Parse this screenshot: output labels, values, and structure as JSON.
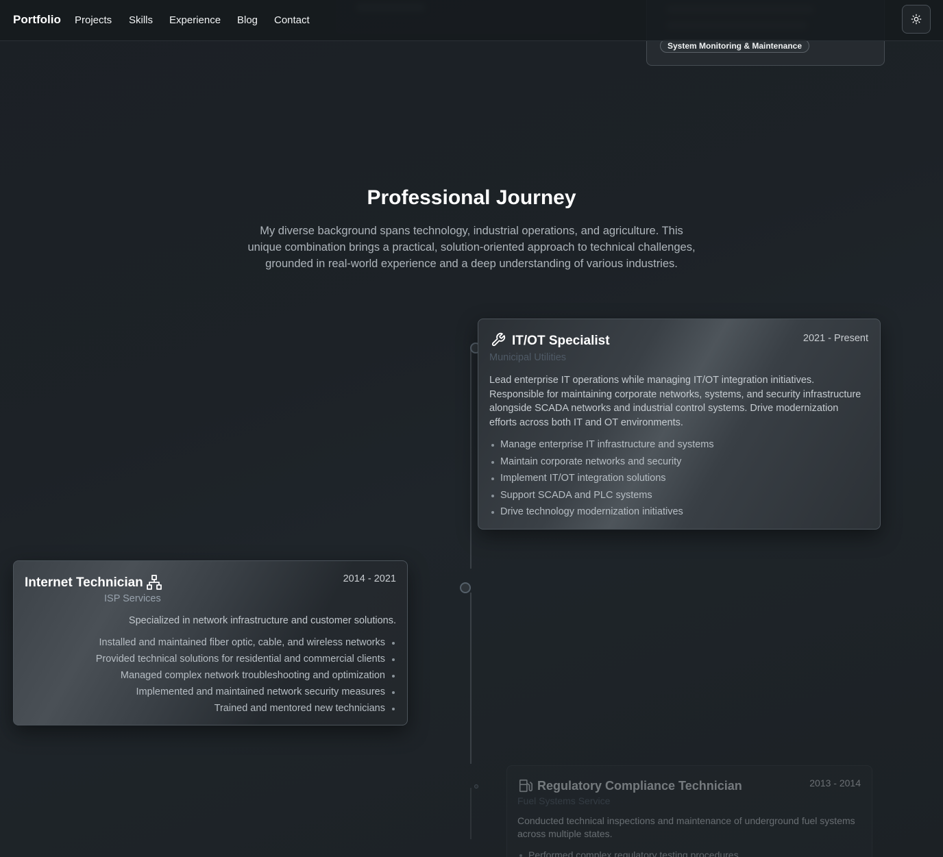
{
  "nav": {
    "brand": "Portfolio",
    "links": [
      "Projects",
      "Skills",
      "Experience",
      "Blog",
      "Contact"
    ],
    "theme_icon": "sun-icon"
  },
  "background_project": {
    "tag": "System Monitoring & Maintenance"
  },
  "section": {
    "title": "Professional Journey",
    "description": "My diverse background spans technology, industrial operations, and agriculture. This unique combination brings a practical, solution-oriented approach to technical challenges, grounded in real-world experience and a deep understanding of various industries."
  },
  "experience": [
    {
      "title": "IT/OT Specialist",
      "icon": "wrench-icon",
      "dates": "2021 - Present",
      "org": "Municipal Utilities",
      "description": "Lead enterprise IT operations while managing IT/OT integration initiatives. Responsible for maintaining corporate networks, systems, and security infrastructure alongside SCADA networks and industrial control systems. Drive modernization efforts across both IT and OT environments.",
      "bullets": [
        "Manage enterprise IT infrastructure and systems",
        "Maintain corporate networks and security",
        "Implement IT/OT integration solutions",
        "Support SCADA and PLC systems",
        "Drive technology modernization initiatives"
      ]
    },
    {
      "title": "Internet Technician",
      "icon": "network-icon",
      "dates": "2014 - 2021",
      "org": "ISP Services",
      "description": "Specialized in network infrastructure and customer solutions.",
      "bullets": [
        "Installed and maintained fiber optic, cable, and wireless networks",
        "Provided technical solutions for residential and commercial clients",
        "Managed complex network troubleshooting and optimization",
        "Implemented and maintained network security measures",
        "Trained and mentored new technicians"
      ]
    },
    {
      "title": "Regulatory Compliance Technician",
      "icon": "fuel-pump-icon",
      "dates": "2013 - 2014",
      "org": "Fuel Systems Service",
      "description": "Conducted technical inspections and maintenance of underground fuel systems across multiple states.",
      "bullets": [
        "Performed complex regulatory testing procedures"
      ]
    }
  ]
}
